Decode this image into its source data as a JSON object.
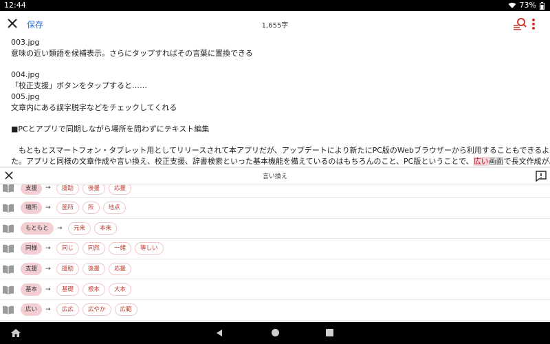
{
  "status_bar": {
    "time": "12:44",
    "battery": "73%"
  },
  "toolbar": {
    "save_label": "保存",
    "char_count": "1,655字"
  },
  "editor": {
    "lines": [
      "003.jpg",
      "意味の近い類語を候補表示。さらにタップすればその言葉に置換できる",
      "",
      "004.jpg",
      "「校正支援」ボタンをタップすると……",
      "005.jpg",
      "文章内にある誤字脱字などをチェックしてくれる",
      "",
      "■PCとアプリで同期しながら場所を問わずにテキスト編集",
      ""
    ],
    "paragraph_line1": "　もともとスマートフォン・タブレット用としてリリースされて本アプリだが、アップデートにより新たにPC版のWebブラウザーから利用することもできるようになっ",
    "paragraph_line2_before": "た。アプリと同様の文章作成や言い換え、校正支援、辞書検索といった基本機能を備えているのはもちろんのこと、PC版ということで、",
    "paragraph_line2_highlight": "広い",
    "paragraph_line2_after": "画面で長文作成がより楽にこ"
  },
  "panel": {
    "title": "言い換え"
  },
  "rephrase_rows": [
    {
      "word": "支援",
      "candidates": [
        "援助",
        "後援",
        "応援"
      ]
    },
    {
      "word": "場所",
      "candidates": [
        "箇所",
        "所",
        "地点"
      ]
    },
    {
      "word": "もともと",
      "candidates": [
        "元来",
        "本来"
      ]
    },
    {
      "word": "同様",
      "candidates": [
        "同じ",
        "同然",
        "一緒",
        "等しい"
      ]
    },
    {
      "word": "支援",
      "candidates": [
        "援助",
        "後援",
        "応援"
      ]
    },
    {
      "word": "基本",
      "candidates": [
        "基礎",
        "根本",
        "大本"
      ]
    },
    {
      "word": "広い",
      "candidates": [
        "広広",
        "広やか",
        "広範"
      ]
    }
  ],
  "arrow_symbol": "→",
  "colors": {
    "accent_blue": "#2a6fd6",
    "highlight_red": "#c0392b",
    "chip_fill": "#f3cfd3"
  }
}
